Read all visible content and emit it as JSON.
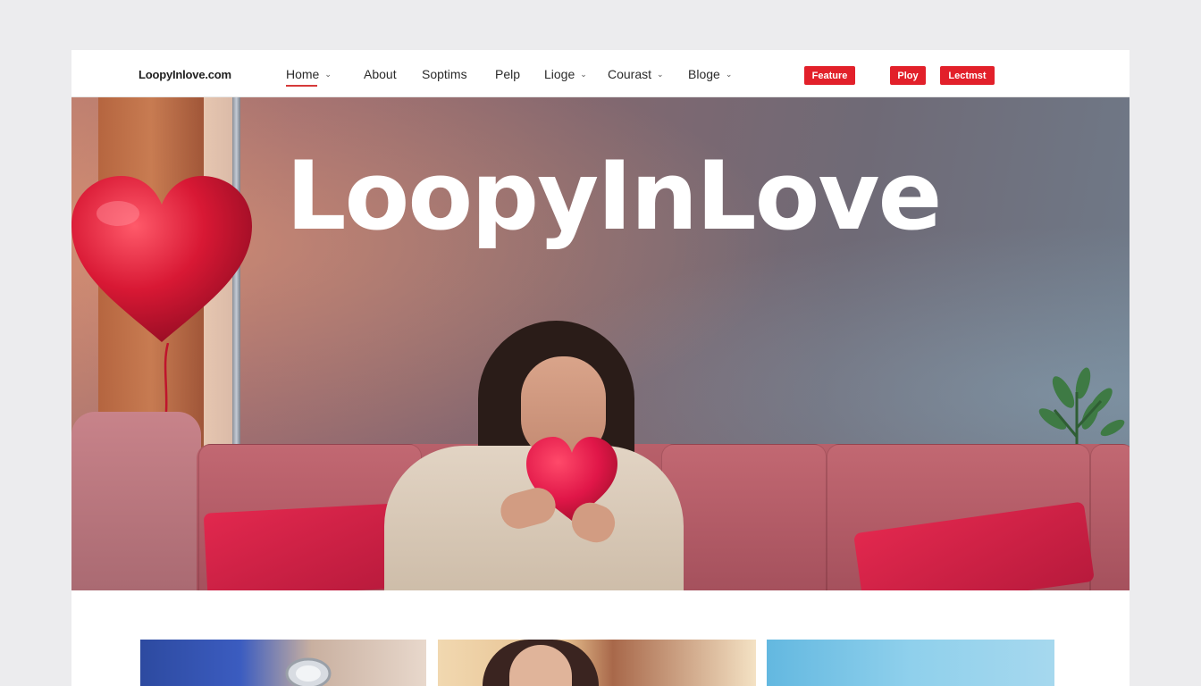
{
  "site": {
    "logo": "LoopyInlove.com"
  },
  "nav": {
    "items": [
      {
        "label": "Home",
        "chevron": true,
        "active": true
      },
      {
        "label": "About",
        "chevron": false,
        "active": false
      },
      {
        "label": "Soptims",
        "chevron": false,
        "active": false
      },
      {
        "label": "Pelp",
        "chevron": false,
        "active": false
      },
      {
        "label": "Lioge",
        "chevron": true,
        "active": false
      },
      {
        "label": "Courast",
        "chevron": true,
        "active": false
      },
      {
        "label": "Bloge",
        "chevron": true,
        "active": false
      }
    ],
    "chevron_glyph": "⌄",
    "buttons": {
      "feature": "Feature",
      "ploy": "Ploy",
      "lectmst": "Lectmst"
    }
  },
  "hero": {
    "title": "LoopyInLove"
  },
  "colors": {
    "accent": "#e2202a",
    "active_underline": "#d63a3a"
  }
}
